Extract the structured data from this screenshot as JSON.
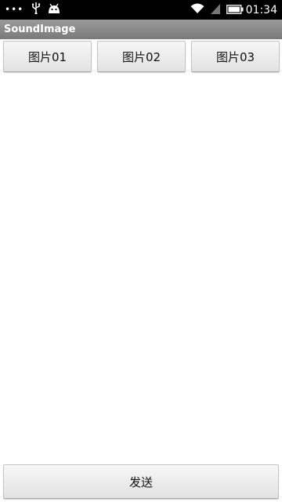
{
  "status_bar": {
    "overflow_dots": "•••",
    "icons": [
      "usb-icon",
      "android-icon",
      "wifi-icon",
      "signal-icon",
      "battery-icon"
    ],
    "time": "01:34"
  },
  "app": {
    "title": "SoundImage"
  },
  "buttons": [
    {
      "label": "图片01"
    },
    {
      "label": "图片02"
    },
    {
      "label": "图片03"
    }
  ],
  "send_button": {
    "label": "发送"
  },
  "colors": {
    "status_bar": "#000000",
    "title_bar": "#8a8a8a",
    "background": "#ffffff"
  }
}
